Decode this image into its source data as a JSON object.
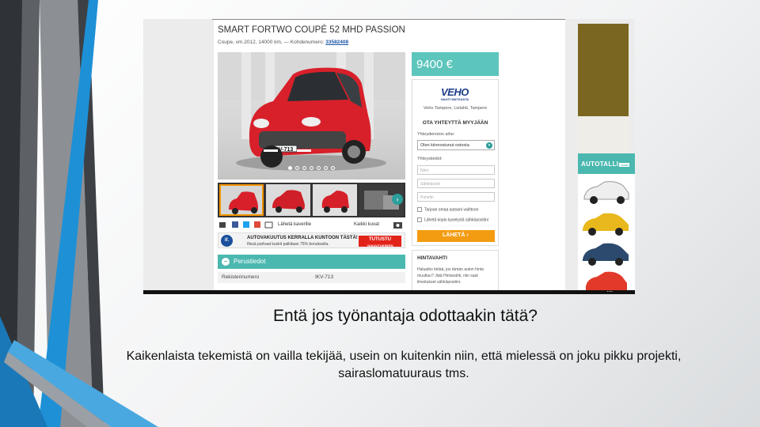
{
  "slide": {
    "heading": "Entä jos työnantaja odottaakin tätä?",
    "body": "Kaikenlaista tekemistä on vailla tekijää, usein on kuitenkin niin, että mielessä on joku pikku projekti, sairaslomatuuraus  tms."
  },
  "listing": {
    "title": "SMART FORTWO COUPÉ 52 MHD PASSION",
    "meta_prefix": "Coupe, vm.2012, 14000 km, — Kohdenumero: ",
    "reference": "33582408",
    "plate": "IKV-713",
    "gallery_dots": 7,
    "share_label": "Lähetä kaverille",
    "all_images_label": "Kaikki kuvat",
    "banner_logo": "if.",
    "banner_title": "AUTOVAKUUTUS KERRALLA KUNTOON TÄSTÄ!",
    "banner_sub": "Ifissä parhaat kuskit palkitaan 75% bonuksella.",
    "banner_button_line1": "TUTUSTU",
    "banner_button_line2": "VAKUUTUKSEEN",
    "basic_info_title": "Perustiedot",
    "basic_rows": [
      {
        "label": "Rekisterinumero",
        "value": "IKV-713"
      }
    ]
  },
  "sidebar": {
    "price": "9400 €",
    "dealer_logo": "VEHO",
    "dealer_logo_sub": "NAUTI MATKASTA",
    "dealer_location": "Veho Tampere, Lielahti, Tampere",
    "contact_cta": "OTA YHTEYTTÄ MYYJÄÄN",
    "subject_label": "Yhteydenoton aihe:",
    "subject_value": "Olen kiinnostunut ostosta",
    "contact_label": "Yhteystiedot:",
    "fields": [
      "Nimi",
      "Sähköposti",
      "Puhelin"
    ],
    "checkbox_1": "Tarjoan omaa autoani vaihtoon",
    "checkbox_2": "Lähetä kopio kyselystä sähköpostiini",
    "send_label": "LÄHETÄ",
    "pricewatch_title": "HINTAVAHTI",
    "pricewatch_text": "Haluatko tietää, jos tämän auton hinta muuttuu? Jätä Hintavahti, niin saat ilmoitukset sähköpostiini."
  },
  "ads": {
    "autotalli_brand": "AUTOTALLI",
    "autotalli_suffix": ".com"
  },
  "colors": {
    "teal": "#4bb8b0",
    "orange": "#f39c12",
    "red": "#e2231a",
    "stripe_blue": "#1e90d6",
    "stripe_grey": "#6c7075"
  },
  "icons": [
    "print-icon",
    "facebook-icon",
    "twitter-icon",
    "gplus-icon",
    "mail-icon",
    "camera-icon",
    "chevron-right-icon",
    "chevron-down-icon",
    "minus-icon"
  ]
}
